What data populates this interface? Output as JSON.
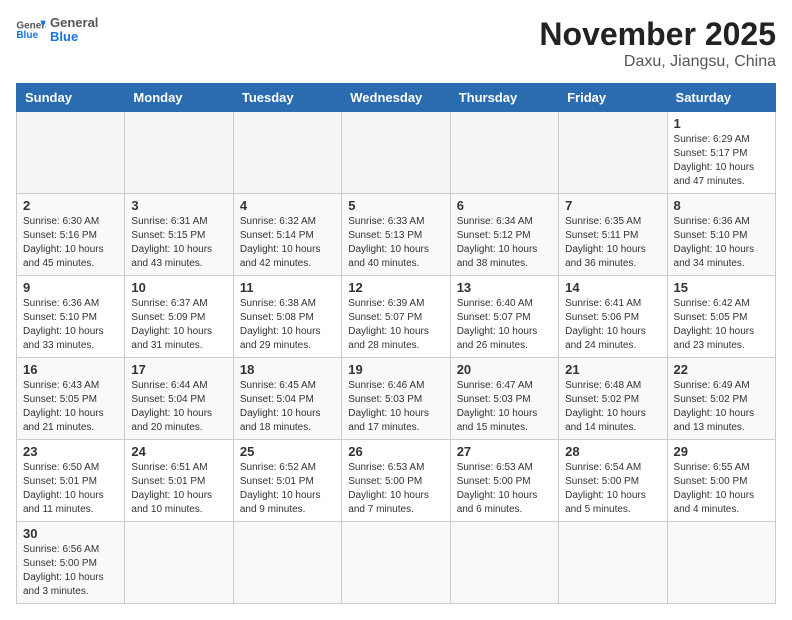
{
  "header": {
    "logo_general": "General",
    "logo_blue": "Blue",
    "month": "November 2025",
    "location": "Daxu, Jiangsu, China"
  },
  "weekdays": [
    "Sunday",
    "Monday",
    "Tuesday",
    "Wednesday",
    "Thursday",
    "Friday",
    "Saturday"
  ],
  "weeks": [
    [
      {
        "day": "",
        "content": ""
      },
      {
        "day": "",
        "content": ""
      },
      {
        "day": "",
        "content": ""
      },
      {
        "day": "",
        "content": ""
      },
      {
        "day": "",
        "content": ""
      },
      {
        "day": "",
        "content": ""
      },
      {
        "day": "1",
        "content": "Sunrise: 6:29 AM\nSunset: 5:17 PM\nDaylight: 10 hours and 47 minutes."
      }
    ],
    [
      {
        "day": "2",
        "content": "Sunrise: 6:30 AM\nSunset: 5:16 PM\nDaylight: 10 hours and 45 minutes."
      },
      {
        "day": "3",
        "content": "Sunrise: 6:31 AM\nSunset: 5:15 PM\nDaylight: 10 hours and 43 minutes."
      },
      {
        "day": "4",
        "content": "Sunrise: 6:32 AM\nSunset: 5:14 PM\nDaylight: 10 hours and 42 minutes."
      },
      {
        "day": "5",
        "content": "Sunrise: 6:33 AM\nSunset: 5:13 PM\nDaylight: 10 hours and 40 minutes."
      },
      {
        "day": "6",
        "content": "Sunrise: 6:34 AM\nSunset: 5:12 PM\nDaylight: 10 hours and 38 minutes."
      },
      {
        "day": "7",
        "content": "Sunrise: 6:35 AM\nSunset: 5:11 PM\nDaylight: 10 hours and 36 minutes."
      },
      {
        "day": "8",
        "content": "Sunrise: 6:36 AM\nSunset: 5:10 PM\nDaylight: 10 hours and 34 minutes."
      }
    ],
    [
      {
        "day": "9",
        "content": "Sunrise: 6:36 AM\nSunset: 5:10 PM\nDaylight: 10 hours and 33 minutes."
      },
      {
        "day": "10",
        "content": "Sunrise: 6:37 AM\nSunset: 5:09 PM\nDaylight: 10 hours and 31 minutes."
      },
      {
        "day": "11",
        "content": "Sunrise: 6:38 AM\nSunset: 5:08 PM\nDaylight: 10 hours and 29 minutes."
      },
      {
        "day": "12",
        "content": "Sunrise: 6:39 AM\nSunset: 5:07 PM\nDaylight: 10 hours and 28 minutes."
      },
      {
        "day": "13",
        "content": "Sunrise: 6:40 AM\nSunset: 5:07 PM\nDaylight: 10 hours and 26 minutes."
      },
      {
        "day": "14",
        "content": "Sunrise: 6:41 AM\nSunset: 5:06 PM\nDaylight: 10 hours and 24 minutes."
      },
      {
        "day": "15",
        "content": "Sunrise: 6:42 AM\nSunset: 5:05 PM\nDaylight: 10 hours and 23 minutes."
      }
    ],
    [
      {
        "day": "16",
        "content": "Sunrise: 6:43 AM\nSunset: 5:05 PM\nDaylight: 10 hours and 21 minutes."
      },
      {
        "day": "17",
        "content": "Sunrise: 6:44 AM\nSunset: 5:04 PM\nDaylight: 10 hours and 20 minutes."
      },
      {
        "day": "18",
        "content": "Sunrise: 6:45 AM\nSunset: 5:04 PM\nDaylight: 10 hours and 18 minutes."
      },
      {
        "day": "19",
        "content": "Sunrise: 6:46 AM\nSunset: 5:03 PM\nDaylight: 10 hours and 17 minutes."
      },
      {
        "day": "20",
        "content": "Sunrise: 6:47 AM\nSunset: 5:03 PM\nDaylight: 10 hours and 15 minutes."
      },
      {
        "day": "21",
        "content": "Sunrise: 6:48 AM\nSunset: 5:02 PM\nDaylight: 10 hours and 14 minutes."
      },
      {
        "day": "22",
        "content": "Sunrise: 6:49 AM\nSunset: 5:02 PM\nDaylight: 10 hours and 13 minutes."
      }
    ],
    [
      {
        "day": "23",
        "content": "Sunrise: 6:50 AM\nSunset: 5:01 PM\nDaylight: 10 hours and 11 minutes."
      },
      {
        "day": "24",
        "content": "Sunrise: 6:51 AM\nSunset: 5:01 PM\nDaylight: 10 hours and 10 minutes."
      },
      {
        "day": "25",
        "content": "Sunrise: 6:52 AM\nSunset: 5:01 PM\nDaylight: 10 hours and 9 minutes."
      },
      {
        "day": "26",
        "content": "Sunrise: 6:53 AM\nSunset: 5:00 PM\nDaylight: 10 hours and 7 minutes."
      },
      {
        "day": "27",
        "content": "Sunrise: 6:53 AM\nSunset: 5:00 PM\nDaylight: 10 hours and 6 minutes."
      },
      {
        "day": "28",
        "content": "Sunrise: 6:54 AM\nSunset: 5:00 PM\nDaylight: 10 hours and 5 minutes."
      },
      {
        "day": "29",
        "content": "Sunrise: 6:55 AM\nSunset: 5:00 PM\nDaylight: 10 hours and 4 minutes."
      }
    ],
    [
      {
        "day": "30",
        "content": "Sunrise: 6:56 AM\nSunset: 5:00 PM\nDaylight: 10 hours and 3 minutes."
      },
      {
        "day": "",
        "content": ""
      },
      {
        "day": "",
        "content": ""
      },
      {
        "day": "",
        "content": ""
      },
      {
        "day": "",
        "content": ""
      },
      {
        "day": "",
        "content": ""
      },
      {
        "day": "",
        "content": ""
      }
    ]
  ]
}
